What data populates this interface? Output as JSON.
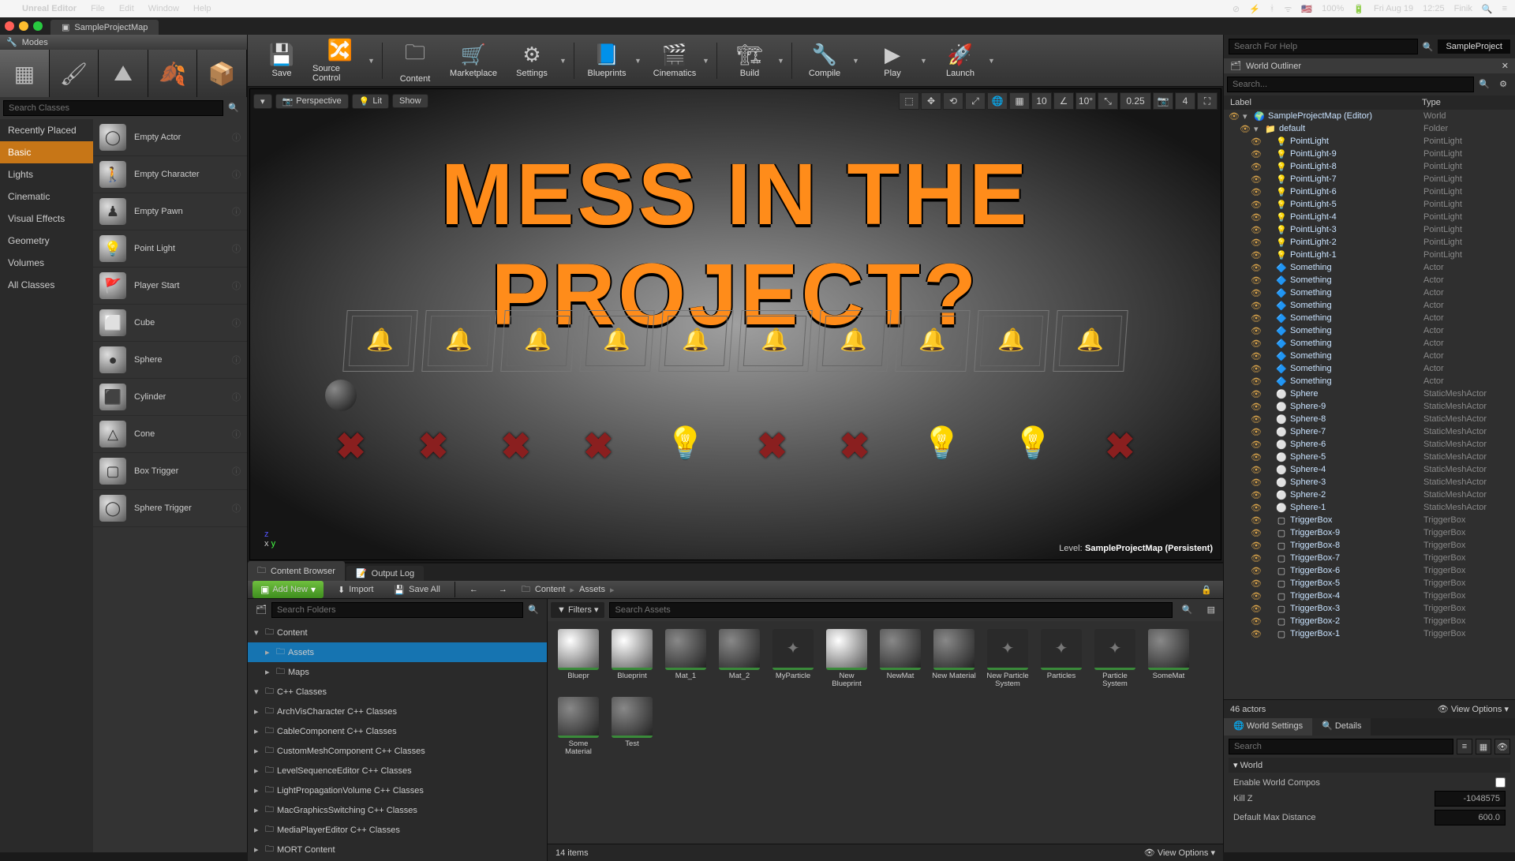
{
  "mac": {
    "app": "Unreal Editor",
    "menus": [
      "File",
      "Edit",
      "Window",
      "Help"
    ],
    "battery": "100%",
    "date": "Fri Aug 19",
    "time": "12:25",
    "user": "Finik"
  },
  "project_tab": "SampleProjectMap",
  "project_name": "SampleProject",
  "help_search_placeholder": "Search For Help",
  "modes": {
    "title": "Modes",
    "search_placeholder": "Search Classes",
    "categories": [
      "Recently Placed",
      "Basic",
      "Lights",
      "Cinematic",
      "Visual Effects",
      "Geometry",
      "Volumes",
      "All Classes"
    ],
    "active_category": "Basic",
    "actors": [
      "Empty Actor",
      "Empty Character",
      "Empty Pawn",
      "Point Light",
      "Player Start",
      "Cube",
      "Sphere",
      "Cylinder",
      "Cone",
      "Box Trigger",
      "Sphere Trigger"
    ]
  },
  "toolbar": [
    "Save",
    "Source Control",
    "Content",
    "Marketplace",
    "Settings",
    "Blueprints",
    "Cinematics",
    "Build",
    "Compile",
    "Play",
    "Launch"
  ],
  "viewport": {
    "mode": "Perspective",
    "lit": "Lit",
    "show": "Show",
    "snap_pos": "10",
    "snap_rot": "10°",
    "snap_scale": "0.25",
    "cam_speed": "4",
    "overlay_title": "MESS IN THE PROJECT?",
    "level_label": "Level:",
    "level_name": "SampleProjectMap (Persistent)"
  },
  "content_browser": {
    "tab1": "Content Browser",
    "tab2": "Output Log",
    "add_new": "Add New",
    "import": "Import",
    "save_all": "Save All",
    "path": [
      "Content",
      "Assets"
    ],
    "tree_search_placeholder": "Search Folders",
    "asset_search_placeholder": "Search Assets",
    "filters_label": "Filters",
    "tree": [
      {
        "label": "Content",
        "depth": 0,
        "open": true,
        "sel": false
      },
      {
        "label": "Assets",
        "depth": 1,
        "open": false,
        "sel": true
      },
      {
        "label": "Maps",
        "depth": 1,
        "open": false,
        "sel": false
      },
      {
        "label": "C++ Classes",
        "depth": 0,
        "open": true,
        "sel": false
      },
      {
        "label": "ArchVisCharacter C++ Classes",
        "depth": 0,
        "open": false,
        "sel": false
      },
      {
        "label": "CableComponent C++ Classes",
        "depth": 0,
        "open": false,
        "sel": false
      },
      {
        "label": "CustomMeshComponent C++ Classes",
        "depth": 0,
        "open": false,
        "sel": false
      },
      {
        "label": "LevelSequenceEditor C++ Classes",
        "depth": 0,
        "open": false,
        "sel": false
      },
      {
        "label": "LightPropagationVolume C++ Classes",
        "depth": 0,
        "open": false,
        "sel": false
      },
      {
        "label": "MacGraphicsSwitching C++ Classes",
        "depth": 0,
        "open": false,
        "sel": false
      },
      {
        "label": "MediaPlayerEditor C++ Classes",
        "depth": 0,
        "open": false,
        "sel": false
      },
      {
        "label": "MORT Content",
        "depth": 0,
        "open": false,
        "sel": false
      }
    ],
    "assets": [
      {
        "name": "Bluepr",
        "kind": "sphere"
      },
      {
        "name": "Blueprint",
        "kind": "sphere"
      },
      {
        "name": "Mat_1",
        "kind": "dark"
      },
      {
        "name": "Mat_2",
        "kind": "dark"
      },
      {
        "name": "MyParticle",
        "kind": "box"
      },
      {
        "name": "New Blueprint",
        "kind": "sphere"
      },
      {
        "name": "NewMat",
        "kind": "dark"
      },
      {
        "name": "New Material",
        "kind": "dark"
      },
      {
        "name": "New Particle System",
        "kind": "box"
      },
      {
        "name": "Particles",
        "kind": "box"
      },
      {
        "name": "Particle System",
        "kind": "box"
      },
      {
        "name": "SomeMat",
        "kind": "dark"
      },
      {
        "name": "Some Material",
        "kind": "dark"
      },
      {
        "name": "Test",
        "kind": "dark"
      }
    ],
    "count_label": "14 items",
    "view_options": "View Options"
  },
  "outliner": {
    "title": "World Outliner",
    "search_placeholder": "Search...",
    "col_label": "Label",
    "col_type": "Type",
    "rows": [
      {
        "d": 0,
        "ic": "🌍",
        "label": "SampleProjectMap (Editor)",
        "type": "World"
      },
      {
        "d": 1,
        "ic": "📁",
        "label": "default",
        "type": "Folder"
      },
      {
        "d": 2,
        "ic": "💡",
        "label": "PointLight",
        "type": "PointLight"
      },
      {
        "d": 2,
        "ic": "💡",
        "label": "PointLight-9",
        "type": "PointLight"
      },
      {
        "d": 2,
        "ic": "💡",
        "label": "PointLight-8",
        "type": "PointLight"
      },
      {
        "d": 2,
        "ic": "💡",
        "label": "PointLight-7",
        "type": "PointLight"
      },
      {
        "d": 2,
        "ic": "💡",
        "label": "PointLight-6",
        "type": "PointLight"
      },
      {
        "d": 2,
        "ic": "💡",
        "label": "PointLight-5",
        "type": "PointLight"
      },
      {
        "d": 2,
        "ic": "💡",
        "label": "PointLight-4",
        "type": "PointLight"
      },
      {
        "d": 2,
        "ic": "💡",
        "label": "PointLight-3",
        "type": "PointLight"
      },
      {
        "d": 2,
        "ic": "💡",
        "label": "PointLight-2",
        "type": "PointLight"
      },
      {
        "d": 2,
        "ic": "💡",
        "label": "PointLight-1",
        "type": "PointLight"
      },
      {
        "d": 2,
        "ic": "🔷",
        "label": "Something",
        "type": "Actor"
      },
      {
        "d": 2,
        "ic": "🔷",
        "label": "Something",
        "type": "Actor"
      },
      {
        "d": 2,
        "ic": "🔷",
        "label": "Something",
        "type": "Actor"
      },
      {
        "d": 2,
        "ic": "🔷",
        "label": "Something",
        "type": "Actor"
      },
      {
        "d": 2,
        "ic": "🔷",
        "label": "Something",
        "type": "Actor"
      },
      {
        "d": 2,
        "ic": "🔷",
        "label": "Something",
        "type": "Actor"
      },
      {
        "d": 2,
        "ic": "🔷",
        "label": "Something",
        "type": "Actor"
      },
      {
        "d": 2,
        "ic": "🔷",
        "label": "Something",
        "type": "Actor"
      },
      {
        "d": 2,
        "ic": "🔷",
        "label": "Something",
        "type": "Actor"
      },
      {
        "d": 2,
        "ic": "🔷",
        "label": "Something",
        "type": "Actor"
      },
      {
        "d": 2,
        "ic": "⚪",
        "label": "Sphere",
        "type": "StaticMeshActor"
      },
      {
        "d": 2,
        "ic": "⚪",
        "label": "Sphere-9",
        "type": "StaticMeshActor"
      },
      {
        "d": 2,
        "ic": "⚪",
        "label": "Sphere-8",
        "type": "StaticMeshActor"
      },
      {
        "d": 2,
        "ic": "⚪",
        "label": "Sphere-7",
        "type": "StaticMeshActor"
      },
      {
        "d": 2,
        "ic": "⚪",
        "label": "Sphere-6",
        "type": "StaticMeshActor"
      },
      {
        "d": 2,
        "ic": "⚪",
        "label": "Sphere-5",
        "type": "StaticMeshActor"
      },
      {
        "d": 2,
        "ic": "⚪",
        "label": "Sphere-4",
        "type": "StaticMeshActor"
      },
      {
        "d": 2,
        "ic": "⚪",
        "label": "Sphere-3",
        "type": "StaticMeshActor"
      },
      {
        "d": 2,
        "ic": "⚪",
        "label": "Sphere-2",
        "type": "StaticMeshActor"
      },
      {
        "d": 2,
        "ic": "⚪",
        "label": "Sphere-1",
        "type": "StaticMeshActor"
      },
      {
        "d": 2,
        "ic": "▢",
        "label": "TriggerBox",
        "type": "TriggerBox"
      },
      {
        "d": 2,
        "ic": "▢",
        "label": "TriggerBox-9",
        "type": "TriggerBox"
      },
      {
        "d": 2,
        "ic": "▢",
        "label": "TriggerBox-8",
        "type": "TriggerBox"
      },
      {
        "d": 2,
        "ic": "▢",
        "label": "TriggerBox-7",
        "type": "TriggerBox"
      },
      {
        "d": 2,
        "ic": "▢",
        "label": "TriggerBox-6",
        "type": "TriggerBox"
      },
      {
        "d": 2,
        "ic": "▢",
        "label": "TriggerBox-5",
        "type": "TriggerBox"
      },
      {
        "d": 2,
        "ic": "▢",
        "label": "TriggerBox-4",
        "type": "TriggerBox"
      },
      {
        "d": 2,
        "ic": "▢",
        "label": "TriggerBox-3",
        "type": "TriggerBox"
      },
      {
        "d": 2,
        "ic": "▢",
        "label": "TriggerBox-2",
        "type": "TriggerBox"
      },
      {
        "d": 2,
        "ic": "▢",
        "label": "TriggerBox-1",
        "type": "TriggerBox"
      }
    ],
    "footer_count": "46 actors",
    "view_options": "View Options"
  },
  "details": {
    "tab1": "World Settings",
    "tab2": "Details",
    "search_placeholder": "Search",
    "section": "World",
    "rows": [
      {
        "k": "Enable World Compos",
        "v": "",
        "check": true
      },
      {
        "k": "Kill Z",
        "v": "-1048575"
      },
      {
        "k": "Default Max Distance",
        "v": "600.0"
      }
    ]
  }
}
